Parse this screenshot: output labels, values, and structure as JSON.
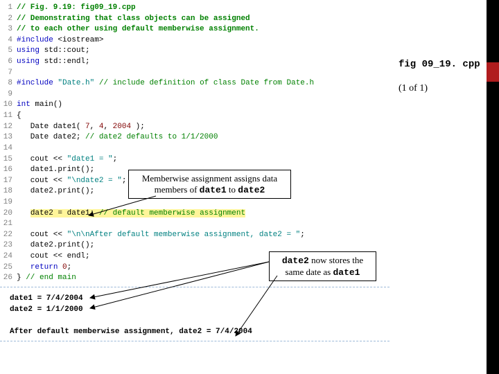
{
  "title": "fig 09_19. cpp",
  "page_indicator": "(1 of 1)",
  "code": [
    {
      "n": 1,
      "seg": [
        {
          "c": "cmt-b",
          "t": "// Fig. 9.19: fig09_19.cpp"
        }
      ]
    },
    {
      "n": 2,
      "seg": [
        {
          "c": "cmt-b",
          "t": "// Demonstrating that class objects can be assigned"
        }
      ]
    },
    {
      "n": 3,
      "seg": [
        {
          "c": "cmt-b",
          "t": "// to each other using default memberwise assignment."
        }
      ]
    },
    {
      "n": 4,
      "seg": [
        {
          "c": "pp",
          "t": "#include "
        },
        {
          "c": "plain",
          "t": "<iostream>"
        }
      ]
    },
    {
      "n": 5,
      "seg": [
        {
          "c": "kw",
          "t": "using"
        },
        {
          "c": "plain",
          "t": " std::cout;"
        }
      ]
    },
    {
      "n": 6,
      "seg": [
        {
          "c": "kw",
          "t": "using"
        },
        {
          "c": "plain",
          "t": " std::endl;"
        }
      ]
    },
    {
      "n": 7,
      "seg": [
        {
          "c": "plain",
          "t": " "
        }
      ]
    },
    {
      "n": 8,
      "seg": [
        {
          "c": "pp",
          "t": "#include "
        },
        {
          "c": "str",
          "t": "\"Date.h\""
        },
        {
          "c": "plain",
          "t": " "
        },
        {
          "c": "cmt",
          "t": "// include definition of class Date from Date.h"
        }
      ]
    },
    {
      "n": 9,
      "seg": [
        {
          "c": "plain",
          "t": " "
        }
      ]
    },
    {
      "n": 10,
      "seg": [
        {
          "c": "kw",
          "t": "int"
        },
        {
          "c": "plain",
          "t": " main()"
        }
      ]
    },
    {
      "n": 11,
      "seg": [
        {
          "c": "plain",
          "t": "{"
        }
      ]
    },
    {
      "n": 12,
      "seg": [
        {
          "c": "plain",
          "t": "   Date date1( "
        },
        {
          "c": "num",
          "t": "7"
        },
        {
          "c": "plain",
          "t": ", "
        },
        {
          "c": "num",
          "t": "4"
        },
        {
          "c": "plain",
          "t": ", "
        },
        {
          "c": "num",
          "t": "2004"
        },
        {
          "c": "plain",
          "t": " );"
        }
      ]
    },
    {
      "n": 13,
      "seg": [
        {
          "c": "plain",
          "t": "   Date date2; "
        },
        {
          "c": "cmt",
          "t": "// date2 defaults to 1/1/2000"
        }
      ]
    },
    {
      "n": 14,
      "seg": [
        {
          "c": "plain",
          "t": " "
        }
      ]
    },
    {
      "n": 15,
      "seg": [
        {
          "c": "plain",
          "t": "   cout << "
        },
        {
          "c": "str",
          "t": "\"date1 = \""
        },
        {
          "c": "plain",
          "t": ";"
        }
      ]
    },
    {
      "n": 16,
      "seg": [
        {
          "c": "plain",
          "t": "   date1.print();"
        }
      ]
    },
    {
      "n": 17,
      "seg": [
        {
          "c": "plain",
          "t": "   cout << "
        },
        {
          "c": "str",
          "t": "\"\\ndate2 = \""
        },
        {
          "c": "plain",
          "t": ";"
        }
      ]
    },
    {
      "n": 18,
      "seg": [
        {
          "c": "plain",
          "t": "   date2.print();"
        }
      ]
    },
    {
      "n": 19,
      "seg": [
        {
          "c": "plain",
          "t": " "
        }
      ]
    },
    {
      "n": 20,
      "seg": [
        {
          "c": "plain",
          "t": "   "
        },
        {
          "c": "hl",
          "t": "date2 = date1; // default memberwise assignment"
        }
      ],
      "hlcmt": true
    },
    {
      "n": 21,
      "seg": [
        {
          "c": "plain",
          "t": " "
        }
      ]
    },
    {
      "n": 22,
      "seg": [
        {
          "c": "plain",
          "t": "   cout << "
        },
        {
          "c": "str",
          "t": "\"\\n\\nAfter default memberwise assignment, date2 = \""
        },
        {
          "c": "plain",
          "t": ";"
        }
      ]
    },
    {
      "n": 23,
      "seg": [
        {
          "c": "plain",
          "t": "   date2.print();"
        }
      ]
    },
    {
      "n": 24,
      "seg": [
        {
          "c": "plain",
          "t": "   cout << endl;"
        }
      ]
    },
    {
      "n": 25,
      "seg": [
        {
          "c": "plain",
          "t": "   "
        },
        {
          "c": "kw",
          "t": "return"
        },
        {
          "c": "plain",
          "t": " "
        },
        {
          "c": "num",
          "t": "0"
        },
        {
          "c": "plain",
          "t": ";"
        }
      ]
    },
    {
      "n": 26,
      "seg": [
        {
          "c": "plain",
          "t": "} "
        },
        {
          "c": "cmt",
          "t": "// end main"
        }
      ]
    }
  ],
  "callout1_l1": "Memberwise assignment assigns data",
  "callout1_l2a": "members of ",
  "callout1_l2b": "date1",
  "callout1_l2c": " to ",
  "callout1_l2d": "date2",
  "callout2_l1a": "date2",
  "callout2_l1b": " now stores the",
  "callout2_l2a": "same date as ",
  "callout2_l2b": "date1",
  "output": [
    "date1 = 7/4/2004",
    "date2 = 1/1/2000",
    "",
    "After default memberwise assignment, date2 = 7/4/2004"
  ]
}
